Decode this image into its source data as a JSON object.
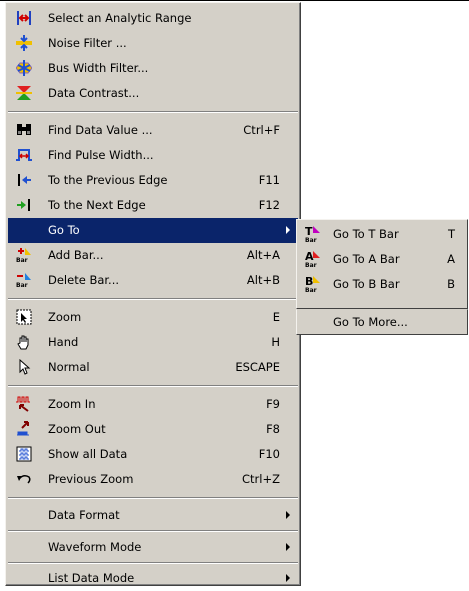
{
  "menu": {
    "items": [
      {
        "label": "Select an Analytic Range",
        "shortcut": "",
        "icon": "analytic-range-icon"
      },
      {
        "label": "Noise Filter ...",
        "shortcut": "",
        "icon": "noise-filter-icon"
      },
      {
        "label": "Bus Width Filter...",
        "shortcut": "",
        "icon": "bus-width-filter-icon"
      },
      {
        "label": "Data Contrast...",
        "shortcut": "",
        "icon": "data-contrast-icon"
      },
      {
        "label": "Find Data Value ...",
        "shortcut": "Ctrl+F",
        "icon": "binoculars-icon"
      },
      {
        "label": "Find Pulse Width...",
        "shortcut": "",
        "icon": "pulse-width-icon"
      },
      {
        "label": "To the Previous Edge",
        "shortcut": "F11",
        "icon": "previous-edge-icon"
      },
      {
        "label": "To the Next Edge",
        "shortcut": "F12",
        "icon": "next-edge-icon"
      },
      {
        "label": "Go To",
        "shortcut": "",
        "icon": ""
      },
      {
        "label": "Add Bar...",
        "shortcut": "Alt+A",
        "icon": "add-bar-icon"
      },
      {
        "label": "Delete Bar...",
        "shortcut": "Alt+B",
        "icon": "delete-bar-icon"
      },
      {
        "label": "Zoom",
        "shortcut": "E",
        "icon": "zoom-select-icon"
      },
      {
        "label": "Hand",
        "shortcut": "H",
        "icon": "hand-icon"
      },
      {
        "label": "Normal",
        "shortcut": "ESCAPE",
        "icon": "pointer-icon"
      },
      {
        "label": "Zoom In",
        "shortcut": "F9",
        "icon": "zoom-in-icon"
      },
      {
        "label": "Zoom Out",
        "shortcut": "F8",
        "icon": "zoom-out-icon"
      },
      {
        "label": "Show all Data",
        "shortcut": "F10",
        "icon": "show-all-data-icon"
      },
      {
        "label": "Previous Zoom",
        "shortcut": "Ctrl+Z",
        "icon": "undo-zoom-icon"
      },
      {
        "label": "Data Format",
        "shortcut": "",
        "icon": ""
      },
      {
        "label": "Waveform Mode",
        "shortcut": "",
        "icon": ""
      },
      {
        "label": "List Data Mode",
        "shortcut": "",
        "icon": ""
      }
    ],
    "highlight_color": "#0a246a",
    "background_color": "#d4d0c8"
  },
  "submenu": {
    "items": [
      {
        "label": "Go To T Bar",
        "shortcut": "T",
        "icon": "t-bar-icon"
      },
      {
        "label": "Go To A Bar",
        "shortcut": "A",
        "icon": "a-bar-icon"
      },
      {
        "label": "Go To B Bar",
        "shortcut": "B",
        "icon": "b-bar-icon"
      },
      {
        "label": "Go To More...",
        "shortcut": "",
        "icon": ""
      }
    ]
  }
}
